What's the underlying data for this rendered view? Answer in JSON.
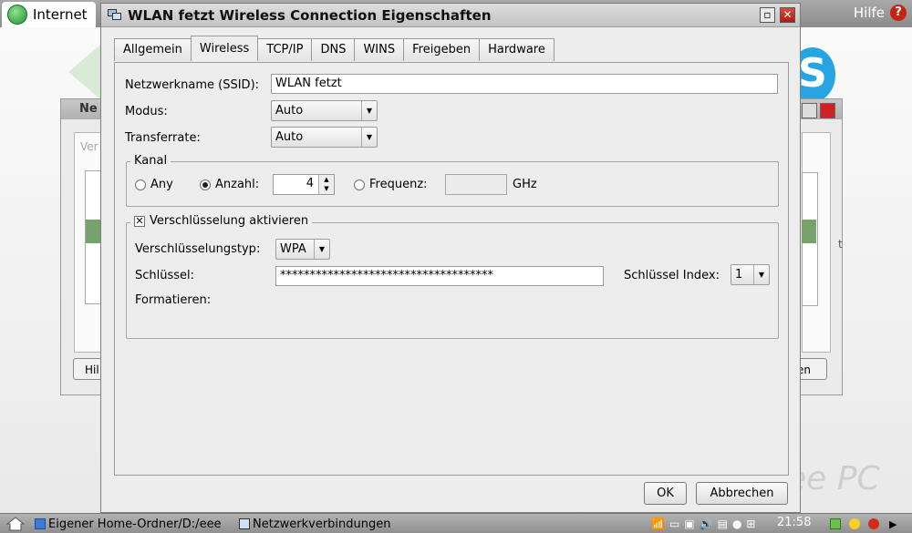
{
  "desktop": {
    "top_tab": "Internet",
    "help_label": "Hilfe",
    "help_glyph": "?",
    "skype_glyph": "S",
    "brand_fragment": "ee PC"
  },
  "background_dialog": {
    "title_fragment": "Ne",
    "left_button_fragment": "Hil",
    "right_button_fragment": "en",
    "side_text_left": "Ver",
    "side_text_right": "t"
  },
  "dialog": {
    "title": "WLAN fetzt Wireless Connection Eigenschaften",
    "tabs": [
      "Allgemein",
      "Wireless",
      "TCP/IP",
      "DNS",
      "WINS",
      "Freigeben",
      "Hardware"
    ],
    "active_tab": "Wireless",
    "ssid_label": "Netzwerkname (SSID):",
    "ssid_value": "WLAN fetzt",
    "modus_label": "Modus:",
    "modus_value": "Auto",
    "transfer_label": "Transferrate:",
    "transfer_value": "Auto",
    "kanal": {
      "title": "Kanal",
      "any_label": "Any",
      "anzahl_label": "Anzahl:",
      "anzahl_value": "4",
      "frequenz_label": "Frequenz:",
      "frequenz_unit": "GHz",
      "selected": "Anzahl"
    },
    "encryption": {
      "checkbox_label": "Verschlüsselung aktivieren",
      "checked": true,
      "type_label": "Verschlüsselungstyp:",
      "type_value": "WPA",
      "key_label": "Schlüssel:",
      "key_value": "************************************",
      "index_label": "Schlüssel Index:",
      "index_value": "1",
      "format_label": "Formatieren:"
    },
    "ok_label": "OK",
    "cancel_label": "Abbrechen"
  },
  "taskbar": {
    "items": [
      "Eigener Home-Ordner/D:/eee",
      "Netzwerkverbindungen"
    ],
    "clock": "21:58"
  }
}
